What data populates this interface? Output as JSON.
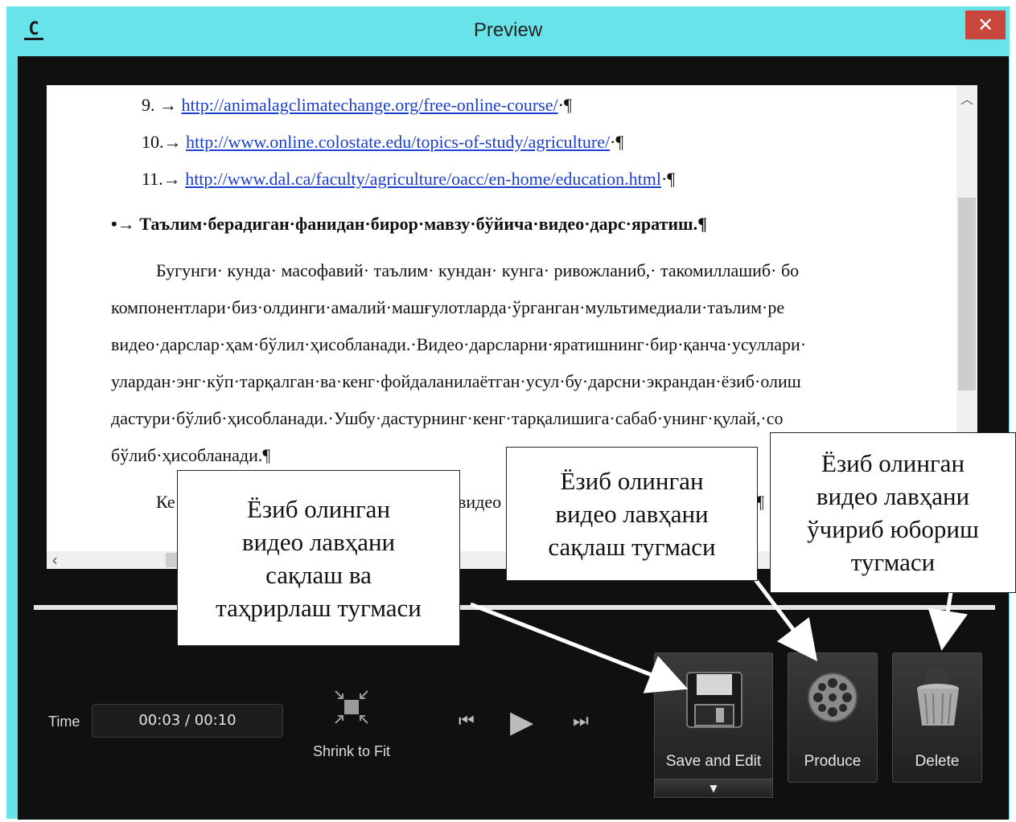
{
  "window": {
    "title": "Preview",
    "app_icon": "C",
    "close_label": "✕"
  },
  "document": {
    "list": [
      {
        "num": "9. →",
        "url": "http://animalagclimatechange.org/free-online-course/",
        "tail": "·¶"
      },
      {
        "num": "10.→",
        "url": "http://www.online.colostate.edu/topics-of-study/agriculture/",
        "tail": "·¶"
      },
      {
        "num": "11.→",
        "url": "http://www.dal.ca/faculty/agriculture/oacc/en-home/education.html",
        "tail": "·¶"
      }
    ],
    "heading": "•→ Таълим·берадиган·фанидан·бирор·мавзу·бўйича·видео·дарс·яратиш.¶",
    "paragraph": [
      "Бугунги· кунда· масофавий· таълим· кундан· кунга· ривожланиб,· такомиллашиб· бо",
      "компонентлари·биз·олдинги·амалий·машғулотларда·ўрганган·мультимедиали·таълим·ре",
      "видео·дарслар·ҳам·бўлил·ҳисобланади.·Видео·дарсларни·яратишнинг·бир·қанча·усуллари·",
      "улардан·энг·кўп·тарқалган·ва·кенг·фойдаланилаётган·усул·бу·дарсни·экрандан·ёзиб·олиш",
      "дастури·бўлиб·ҳисобланади.·Ушбу·дастурнинг·кенг·тарқалишига·сабаб·унинг·қулай,·со",
      "бўлиб·ҳисобланади.¶"
    ],
    "partial_line_start": "Ке",
    "partial_line_mid": "видео",
    "partial_line_end": "¶"
  },
  "controls": {
    "time_label": "Time",
    "time_value": "00:03  /  00:10",
    "shrink_label": "Shrink to Fit",
    "save_edit_label": "Save and Edit",
    "produce_label": "Produce",
    "delete_label": "Delete",
    "dropdown_arrow": "▼",
    "prev_icon": "⏮",
    "play_icon": "▶",
    "next_icon": "⏭"
  },
  "callouts": {
    "save_edit": [
      "Ёзиб олинган",
      "видео лавҳани",
      "сақлаш ва",
      "таҳрирлаш тугмаси"
    ],
    "produce": [
      "Ёзиб олинган",
      "видео лавҳани",
      "сақлаш тугмаси"
    ],
    "delete": [
      "Ёзиб олинган",
      "видео лавҳани",
      "ўчириб юбориш",
      "тугмаси"
    ]
  }
}
